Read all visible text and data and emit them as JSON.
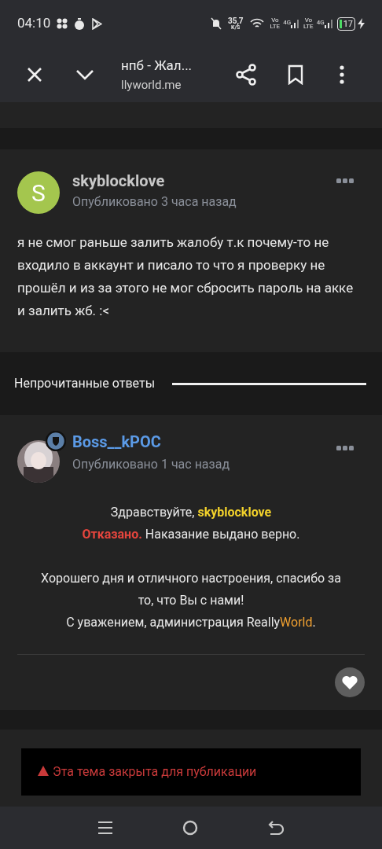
{
  "status_bar": {
    "time": "04:10",
    "speed": "35,7",
    "speed_unit": "K/S",
    "sims": [
      {
        "top": "Vo",
        "bottom": "LTE",
        "net": "4G"
      },
      {
        "top": "Vo",
        "bottom": "LTE",
        "net": "4G"
      }
    ],
    "battery": "17"
  },
  "toolbar": {
    "title": "нпб - Жал...",
    "url": "llyworld.me"
  },
  "post": {
    "avatar_letter": "S",
    "author": "skyblocklove",
    "time": "Опубликовано 3 часа назад",
    "body": "я не смог раньше залить жалобу т.к почему-то не входило в аккаунт и писало то что я проверку не прошёл и из за этого не мог сбросить пароль на акке и залить жб. :<"
  },
  "unread_heading": "Непрочитанные ответы",
  "reply": {
    "author": "Boss__kPOC",
    "time": "Опубликовано 1 час назад",
    "paragraphs": [
      [
        [
          {
            "kind": "plain",
            "text": "Здравствуйте, "
          },
          {
            "kind": "mention",
            "text": "skyblocklove"
          }
        ],
        [
          {
            "kind": "denied",
            "text": "Отказано."
          },
          {
            "kind": "plain",
            "text": " Наказание выдано верно."
          }
        ]
      ],
      [
        [
          {
            "kind": "plain",
            "text": "Хорошего дня и отличного настроения, спасибо за то, что Вы с нами!"
          }
        ],
        [
          {
            "kind": "plain",
            "text": "С уважением, администрация Really"
          },
          {
            "kind": "brand",
            "text": "World"
          },
          {
            "kind": "plain",
            "text": "."
          }
        ]
      ]
    ]
  },
  "notice": "Эта тема закрыта для публикации"
}
